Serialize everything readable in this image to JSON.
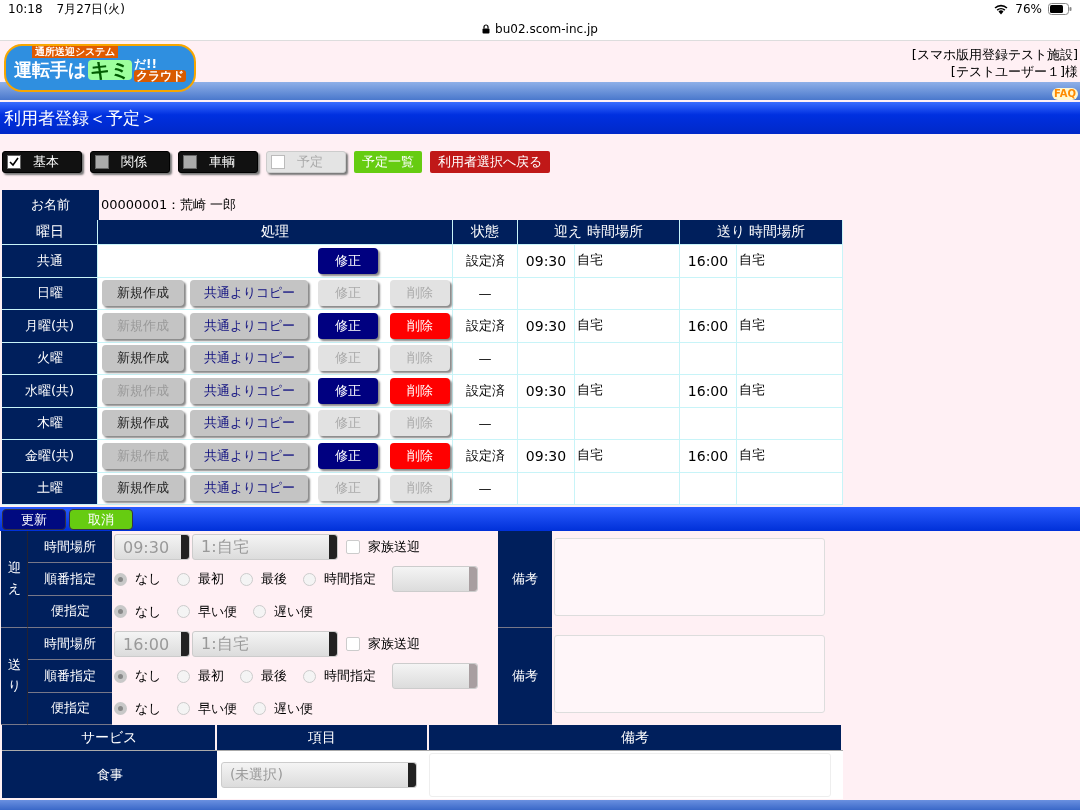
{
  "status_bar": {
    "time": "10:18",
    "date": "7月27日(火)",
    "battery": "76%"
  },
  "browser": {
    "url": "bu02.scom-inc.jp"
  },
  "header": {
    "logo": {
      "tagline": "通所送迎システム",
      "title": "運転手は",
      "highlight": "キミ",
      "exclaim": "だ!!",
      "subtitle": "クラウド"
    },
    "facility": "[スマホ版用登録テスト施設]",
    "user": "[テストユーザー１]様",
    "faq": "FAQ"
  },
  "page_title": "利用者登録＜予定＞",
  "tabs": [
    {
      "label": "基本",
      "checked": true,
      "disabled": false
    },
    {
      "label": "関係",
      "checked": false,
      "disabled": false
    },
    {
      "label": "車輌",
      "checked": false,
      "disabled": false
    },
    {
      "label": "予定",
      "checked": false,
      "disabled": true
    }
  ],
  "nav_buttons": [
    {
      "kind": "list",
      "label": "予定一覧"
    },
    {
      "kind": "back",
      "label": "利用者選択へ戻る"
    }
  ],
  "name_row": {
    "label": "お名前",
    "value": "00000001：荒崎 一郎"
  },
  "schedule": {
    "columns": [
      "曜日",
      "処理",
      "状態",
      "迎え 時間場所",
      "送り 時間場所"
    ],
    "rows": [
      {
        "day": "共通",
        "actions": [
          {
            "kind": "edit",
            "label": "修正",
            "disabled": false
          }
        ],
        "status": "設定済",
        "pickup_time": "09:30",
        "pickup_place": "自宅",
        "dropoff_time": "16:00",
        "dropoff_place": "自宅"
      },
      {
        "day": "日曜",
        "actions": [
          {
            "kind": "new",
            "label": "新規作成",
            "disabled": false
          },
          {
            "kind": "copy",
            "label": "共通よりコピー",
            "disabled": false
          },
          {
            "kind": "edit",
            "label": "修正",
            "disabled": true
          },
          {
            "kind": "delete",
            "label": "削除",
            "disabled": true
          }
        ],
        "status": "—"
      },
      {
        "day": "月曜(共)",
        "actions": [
          {
            "kind": "new",
            "label": "新規作成",
            "disabled": true
          },
          {
            "kind": "copy",
            "label": "共通よりコピー",
            "disabled": false
          },
          {
            "kind": "edit",
            "label": "修正",
            "disabled": false
          },
          {
            "kind": "delete",
            "label": "削除",
            "disabled": false
          }
        ],
        "status": "設定済",
        "pickup_time": "09:30",
        "pickup_place": "自宅",
        "dropoff_time": "16:00",
        "dropoff_place": "自宅"
      },
      {
        "day": "火曜",
        "actions": [
          {
            "kind": "new",
            "label": "新規作成",
            "disabled": false
          },
          {
            "kind": "copy",
            "label": "共通よりコピー",
            "disabled": false
          },
          {
            "kind": "edit",
            "label": "修正",
            "disabled": true
          },
          {
            "kind": "delete",
            "label": "削除",
            "disabled": true
          }
        ],
        "status": "—"
      },
      {
        "day": "水曜(共)",
        "actions": [
          {
            "kind": "new",
            "label": "新規作成",
            "disabled": true
          },
          {
            "kind": "copy",
            "label": "共通よりコピー",
            "disabled": false
          },
          {
            "kind": "edit",
            "label": "修正",
            "disabled": false
          },
          {
            "kind": "delete",
            "label": "削除",
            "disabled": false
          }
        ],
        "status": "設定済",
        "pickup_time": "09:30",
        "pickup_place": "自宅",
        "dropoff_time": "16:00",
        "dropoff_place": "自宅"
      },
      {
        "day": "木曜",
        "actions": [
          {
            "kind": "new",
            "label": "新規作成",
            "disabled": false
          },
          {
            "kind": "copy",
            "label": "共通よりコピー",
            "disabled": false
          },
          {
            "kind": "edit",
            "label": "修正",
            "disabled": true
          },
          {
            "kind": "delete",
            "label": "削除",
            "disabled": true
          }
        ],
        "status": "—"
      },
      {
        "day": "金曜(共)",
        "actions": [
          {
            "kind": "new",
            "label": "新規作成",
            "disabled": true
          },
          {
            "kind": "copy",
            "label": "共通よりコピー",
            "disabled": false
          },
          {
            "kind": "edit",
            "label": "修正",
            "disabled": false
          },
          {
            "kind": "delete",
            "label": "削除",
            "disabled": false
          }
        ],
        "status": "設定済",
        "pickup_time": "09:30",
        "pickup_place": "自宅",
        "dropoff_time": "16:00",
        "dropoff_place": "自宅"
      },
      {
        "day": "土曜",
        "actions": [
          {
            "kind": "new",
            "label": "新規作成",
            "disabled": false
          },
          {
            "kind": "copy",
            "label": "共通よりコピー",
            "disabled": false
          },
          {
            "kind": "edit",
            "label": "修正",
            "disabled": true
          },
          {
            "kind": "delete",
            "label": "削除",
            "disabled": true
          }
        ],
        "status": "—"
      }
    ]
  },
  "action_bar": [
    {
      "kind": "update",
      "label": "更新"
    },
    {
      "kind": "cancel",
      "label": "取消"
    }
  ],
  "transport": [
    {
      "label": "迎え",
      "notes_label": "備考",
      "rows": [
        {
          "kind": "time_place",
          "label": "時間場所",
          "time": "09:30",
          "place": "1:自宅",
          "family_label": "家族送迎",
          "family_checked": false
        },
        {
          "kind": "order",
          "label": "順番指定",
          "options": [
            {
              "label": "なし",
              "selected": true
            },
            {
              "label": "最初",
              "selected": false
            },
            {
              "label": "最後",
              "selected": false
            },
            {
              "label": "時間指定",
              "selected": false
            }
          ]
        },
        {
          "kind": "trip",
          "label": "便指定",
          "options": [
            {
              "label": "なし",
              "selected": true
            },
            {
              "label": "早い便",
              "selected": false
            },
            {
              "label": "遅い便",
              "selected": false
            }
          ]
        }
      ]
    },
    {
      "label": "送り",
      "notes_label": "備考",
      "rows": [
        {
          "kind": "time_place",
          "label": "時間場所",
          "time": "16:00",
          "place": "1:自宅",
          "family_label": "家族送迎",
          "family_checked": false
        },
        {
          "kind": "order",
          "label": "順番指定",
          "options": [
            {
              "label": "なし",
              "selected": true
            },
            {
              "label": "最初",
              "selected": false
            },
            {
              "label": "最後",
              "selected": false
            },
            {
              "label": "時間指定",
              "selected": false
            }
          ]
        },
        {
          "kind": "trip",
          "label": "便指定",
          "options": [
            {
              "label": "なし",
              "selected": true
            },
            {
              "label": "早い便",
              "selected": false
            },
            {
              "label": "遅い便",
              "selected": false
            }
          ]
        }
      ]
    }
  ],
  "services": {
    "columns": [
      "サービス",
      "項目",
      "備考"
    ],
    "rows": [
      {
        "service": "食事",
        "item": "(未選択)"
      }
    ]
  }
}
